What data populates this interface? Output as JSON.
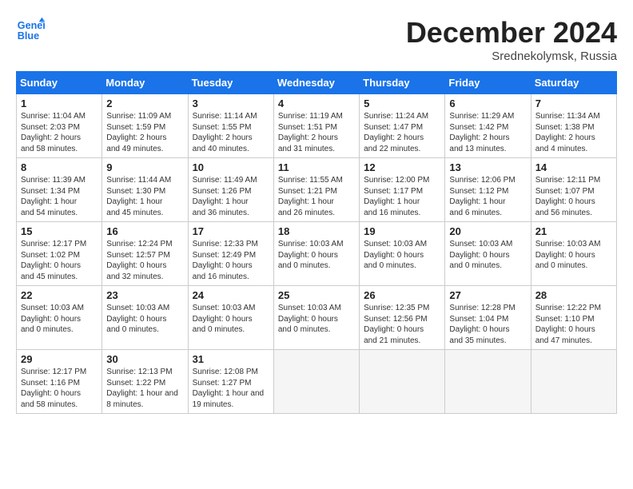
{
  "logo": {
    "line1": "General",
    "line2": "Blue"
  },
  "title": "December 2024",
  "subtitle": "Srednekolymsk, Russia",
  "headers": [
    "Sunday",
    "Monday",
    "Tuesday",
    "Wednesday",
    "Thursday",
    "Friday",
    "Saturday"
  ],
  "weeks": [
    [
      {
        "day": "1",
        "info": "Sunrise: 11:04 AM\nSunset: 2:03 PM\nDaylight: 2 hours\nand 58 minutes."
      },
      {
        "day": "2",
        "info": "Sunrise: 11:09 AM\nSunset: 1:59 PM\nDaylight: 2 hours\nand 49 minutes."
      },
      {
        "day": "3",
        "info": "Sunrise: 11:14 AM\nSunset: 1:55 PM\nDaylight: 2 hours\nand 40 minutes."
      },
      {
        "day": "4",
        "info": "Sunrise: 11:19 AM\nSunset: 1:51 PM\nDaylight: 2 hours\nand 31 minutes."
      },
      {
        "day": "5",
        "info": "Sunrise: 11:24 AM\nSunset: 1:47 PM\nDaylight: 2 hours\nand 22 minutes."
      },
      {
        "day": "6",
        "info": "Sunrise: 11:29 AM\nSunset: 1:42 PM\nDaylight: 2 hours\nand 13 minutes."
      },
      {
        "day": "7",
        "info": "Sunrise: 11:34 AM\nSunset: 1:38 PM\nDaylight: 2 hours\nand 4 minutes."
      }
    ],
    [
      {
        "day": "8",
        "info": "Sunrise: 11:39 AM\nSunset: 1:34 PM\nDaylight: 1 hour\nand 54 minutes."
      },
      {
        "day": "9",
        "info": "Sunrise: 11:44 AM\nSunset: 1:30 PM\nDaylight: 1 hour\nand 45 minutes."
      },
      {
        "day": "10",
        "info": "Sunrise: 11:49 AM\nSunset: 1:26 PM\nDaylight: 1 hour\nand 36 minutes."
      },
      {
        "day": "11",
        "info": "Sunrise: 11:55 AM\nSunset: 1:21 PM\nDaylight: 1 hour\nand 26 minutes."
      },
      {
        "day": "12",
        "info": "Sunrise: 12:00 PM\nSunset: 1:17 PM\nDaylight: 1 hour\nand 16 minutes."
      },
      {
        "day": "13",
        "info": "Sunrise: 12:06 PM\nSunset: 1:12 PM\nDaylight: 1 hour\nand 6 minutes."
      },
      {
        "day": "14",
        "info": "Sunrise: 12:11 PM\nSunset: 1:07 PM\nDaylight: 0 hours\nand 56 minutes."
      }
    ],
    [
      {
        "day": "15",
        "info": "Sunrise: 12:17 PM\nSunset: 1:02 PM\nDaylight: 0 hours\nand 45 minutes."
      },
      {
        "day": "16",
        "info": "Sunrise: 12:24 PM\nSunset: 12:57 PM\nDaylight: 0 hours\nand 32 minutes."
      },
      {
        "day": "17",
        "info": "Sunrise: 12:33 PM\nSunset: 12:49 PM\nDaylight: 0 hours\nand 16 minutes."
      },
      {
        "day": "18",
        "info": "Sunrise: 10:03 AM\nDaylight: 0 hours\nand 0 minutes."
      },
      {
        "day": "19",
        "info": "Sunset: 10:03 AM\nDaylight: 0 hours\nand 0 minutes."
      },
      {
        "day": "20",
        "info": "Sunset: 10:03 AM\nDaylight: 0 hours\nand 0 minutes."
      },
      {
        "day": "21",
        "info": "Sunrise: 10:03 AM\nDaylight: 0 hours\nand 0 minutes."
      }
    ],
    [
      {
        "day": "22",
        "info": "Sunset: 10:03 AM\nDaylight: 0 hours\nand 0 minutes."
      },
      {
        "day": "23",
        "info": "Sunset: 10:03 AM\nDaylight: 0 hours\nand 0 minutes."
      },
      {
        "day": "24",
        "info": "Sunset: 10:03 AM\nDaylight: 0 hours\nand 0 minutes."
      },
      {
        "day": "25",
        "info": "Sunset: 10:03 AM\nDaylight: 0 hours\nand 0 minutes."
      },
      {
        "day": "26",
        "info": "Sunrise: 12:35 PM\nSunset: 12:56 PM\nDaylight: 0 hours\nand 21 minutes."
      },
      {
        "day": "27",
        "info": "Sunrise: 12:28 PM\nSunset: 1:04 PM\nDaylight: 0 hours\nand 35 minutes."
      },
      {
        "day": "28",
        "info": "Sunrise: 12:22 PM\nSunset: 1:10 PM\nDaylight: 0 hours\nand 47 minutes."
      }
    ],
    [
      {
        "day": "29",
        "info": "Sunrise: 12:17 PM\nSunset: 1:16 PM\nDaylight: 0 hours\nand 58 minutes."
      },
      {
        "day": "30",
        "info": "Sunrise: 12:13 PM\nSunset: 1:22 PM\nDaylight: 1 hour and\n8 minutes."
      },
      {
        "day": "31",
        "info": "Sunrise: 12:08 PM\nSunset: 1:27 PM\nDaylight: 1 hour and\n19 minutes."
      },
      {
        "day": "",
        "info": ""
      },
      {
        "day": "",
        "info": ""
      },
      {
        "day": "",
        "info": ""
      },
      {
        "day": "",
        "info": ""
      }
    ]
  ]
}
